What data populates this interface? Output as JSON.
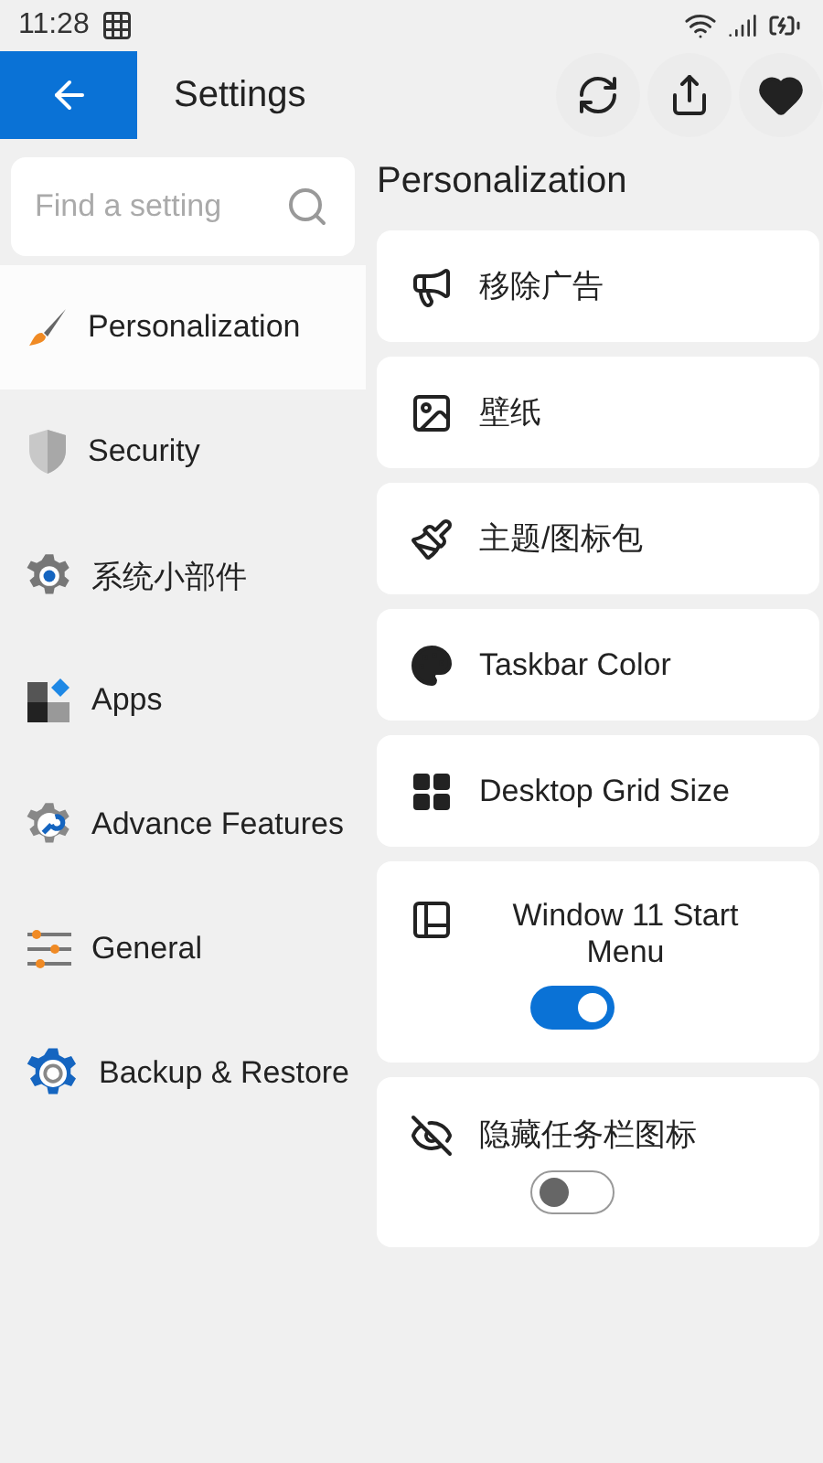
{
  "status_bar": {
    "time": "11:28"
  },
  "header": {
    "title": "Settings"
  },
  "search": {
    "placeholder": "Find a setting"
  },
  "sidebar": {
    "items": [
      {
        "label": "Personalization",
        "selected": true
      },
      {
        "label": "Security",
        "selected": false
      },
      {
        "label": "系统小部件",
        "selected": false
      },
      {
        "label": "Apps",
        "selected": false
      },
      {
        "label": "Advance Features",
        "selected": false
      },
      {
        "label": "General",
        "selected": false
      },
      {
        "label": "Backup & Restore",
        "selected": false
      }
    ]
  },
  "section": {
    "title": "Personalization",
    "cards": [
      {
        "kind": "link",
        "label": "移除广告"
      },
      {
        "kind": "link",
        "label": "壁纸"
      },
      {
        "kind": "link",
        "label": "主题/图标包"
      },
      {
        "kind": "link",
        "label": "Taskbar Color"
      },
      {
        "kind": "link",
        "label": "Desktop Grid Size"
      },
      {
        "kind": "toggle",
        "label": "Window 11 Start Menu",
        "on": true
      },
      {
        "kind": "toggle",
        "label": "隐藏任务栏图标",
        "on": false
      }
    ]
  }
}
